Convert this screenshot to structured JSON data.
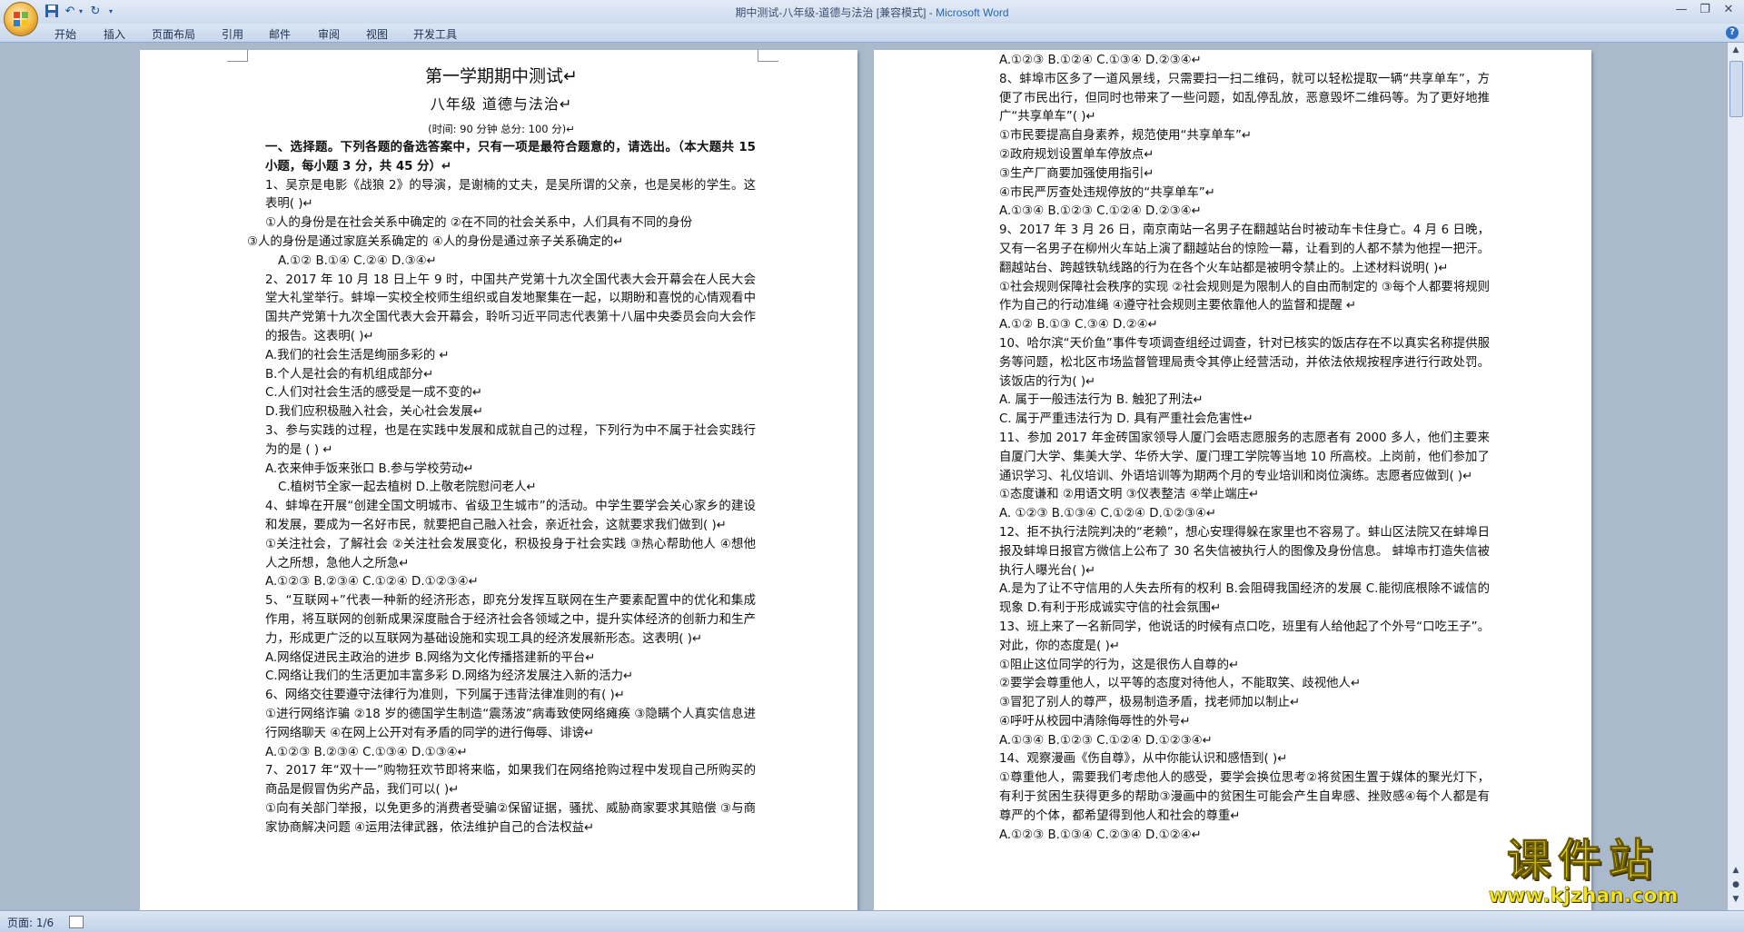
{
  "window": {
    "title": "期中测试-八年级-道德与法治 [兼容模式] - ",
    "app_name": "Microsoft Word"
  },
  "quick_access": [
    "save-icon",
    "undo-icon",
    "redo-icon",
    "customize-icon"
  ],
  "ribbon": {
    "tabs": [
      "开始",
      "插入",
      "页面布局",
      "引用",
      "邮件",
      "审阅",
      "视图",
      "开发工具"
    ],
    "help": "?"
  },
  "status": {
    "page": "页面: 1/6"
  },
  "watermark": {
    "title": "课件站",
    "url": "www.kjzhan.com"
  },
  "colors": {
    "title_bar": "#dfe8f5",
    "workspace": "#abb9cc",
    "watermark": "#f5e71d"
  },
  "page1": {
    "title": "第一学期期中测试↵",
    "subtitle": "八年级    道德与法治↵",
    "meta": "(时间: 90 分钟    总分: 100 分)↵",
    "section": "一、选择题。下列各题的备选答案中，只有一项是最符合题意的，请选出。（本大题共 15 小题，每小题 3 分，共 45 分）↵",
    "q1": "1、吴京是电影《战狼 2》的导演，是谢楠的丈夫，是吴所谓的父亲，也是吴彬的学生。这表明(      )↵",
    "q1_opts1": "①人的身份是在社会关系中确定的    ②在不同的社会关系中，人们具有不同的身份",
    "q1_opts2": "③人的身份是通过家庭关系确定的    ④人的身份是通过亲子关系确定的↵",
    "q1_choices": "A.①②               B.①④               C.②④               D.③④↵",
    "q2": "2、2017 年 10 月 18 日上午 9 时，中国共产党第十九次全国代表大会开幕会在人民大会堂大礼堂举行。蚌埠一实校全校师生组织或自发地聚集在一起，以期盼和喜悦的心情观看中国共产党第十九次全国代表大会开幕会，聆听习近平同志代表第十八届中央委员会向大会作的报告。这表明(      )↵",
    "q2_a": "A.我们的社会生活是绚丽多彩的      ↵",
    "q2_b": "B.个人是社会的有机组成部分↵",
    "q2_c": "C.人们对社会生活的感受是一成不变的↵",
    "q2_d": "D.我们应积极融入社会，关心社会发展↵",
    "q3": "3、参与实践的过程，也是在实践中发展和成就自己的过程，下列行为中不属于社会实践行为的是 (   ) ↵",
    "q3_ab": "A.衣来伸手饭来张口 B.参与学校劳动↵",
    "q3_cd": "C.植树节全家一起去植树 D.上敬老院慰问老人↵",
    "q4": "4、蚌埠在开展“创建全国文明城市、省级卫生城市”的活动。中学生要学会关心家乡的建设和发展，要成为一名好市民，就要把自己融入社会，亲近社会，这就要求我们做到(        )↵",
    "q4_opts": "①关注社会，了解社会  ②关注社会发展变化，积极投身于社会实践  ③热心帮助他人  ④想他人之所想，急他人之所急↵",
    "q4_choices": "A.①②③        B.②③④        C.①②④        D.①②③④↵",
    "q5": "5、“互联网+”代表一种新的经济形态，即充分发挥互联网在生产要素配置中的优化和集成作用，将互联网的创新成果深度融合于经济社会各领域之中，提升实体经济的创新力和生产力，形成更广泛的以互联网为基础设施和实现工具的经济发展新形态。这表明(        )↵",
    "q5_ab": "A.网络促进民主政治的进步        B.网络为文化传播搭建新的平台↵",
    "q5_cd": "C.网络让我们的生活更加丰富多彩 D.网络为经济发展注入新的活力↵",
    "q6": "6、网络交往要遵守法律行为准则，下列属于违背法律准则的有(         )↵",
    "q6_opts": "①进行网络诈骗  ②18 岁的德国学生制造“震荡波”病毒致使网络瘫痪  ③隐瞒个人真实信息进行网络聊天  ④在网上公开对有矛盾的同学的进行侮辱、诽谤↵",
    "q6_choices": "A.①②③               B.②③④               C.①③④               D.①③④↵",
    "q7": "7、2017 年“双十一”购物狂欢节即将来临，如果我们在网络抢购过程中发现自己所购买的商品是假冒伪劣产品，我们可以(       )↵",
    "q7_opts": "①向有关部门举报，以免更多的消费者受骗②保留证据，骚扰、威胁商家要求其赔偿 ③与商家协商解决问题 ④运用法律武器，依法维护自己的合法权益↵"
  },
  "page2": {
    "q7_choices": "A.①②③               B.①②④               C.①③④               D.②③④↵",
    "q8": "8、蚌埠市区多了一道风景线，只需要扫一扫二维码，就可以轻松提取一辆“共享单车”，方便了市民出行，但同时也带来了一些问题，如乱停乱放，恶意毁坏二维码等。为了更好地推广“共享单车”(        )↵",
    "q8_o1": "①市民要提高自身素养，规范使用“共享单车”↵",
    "q8_o2": "②政府规划设置单车停放点↵",
    "q8_o3": "③生产厂商要加强使用指引↵",
    "q8_o4": "④市民严厉查处违规停放的“共享单车”↵",
    "q8_choices": "A.①③④          B.①②③          C.①②④          D.②③④↵",
    "q9": "9、2017 年 3 月 26 日，南京南站一名男子在翻越站台时被动车卡住身亡。4 月 6 日晚，又有一名男子在柳州火车站上演了翻越站台的惊险一幕，让看到的人都不禁为他捏一把汗。翻越站台、跨越铁轨线路的行为在各个火车站都是被明令禁止的。上述材料说明(        )↵",
    "q9_opts": "①社会规则保障社会秩序的实现  ②社会规则是为限制人的自由而制定的  ③每个人都要将规则作为自己的行动准绳  ④遵守社会规则主要依靠他人的监督和提醒       ↵",
    "q9_choices": "A.①②    B.①③    C.③④    D.②④↵",
    "q10": "10、哈尔滨“天价鱼”事件专项调查组经过调查，针对已核实的饭店存在不以真实名称提供服务等问题，松北区市场监督管理局责令其停止经营活动，并依法依规按程序进行行政处罚。该饭店的行为(          )↵",
    "q10_ab": "A. 属于一般违法行为          B. 触犯了刑法↵",
    "q10_cd": "C. 属于严重违法行为          D. 具有严重社会危害性↵",
    "q11": "11、参加 2017 年金砖国家领导人厦门会晤志愿服务的志愿者有 2000 多人，他们主要来自厦门大学、集美大学、华侨大学、厦门理工学院等当地 10 所高校。上岗前，他们参加了通识学习、礼仪培训、外语培训等为期两个月的专业培训和岗位演练。志愿者应做到(        )↵",
    "q11_opts": "①态度谦和      ②用语文明        ③仪表整洁      ④举止端庄↵",
    "q11_choices": "A.   ①②③           B.①③④   C.①②④           D.①②③④↵",
    "q12": "12、拒不执行法院判决的“老赖”，想心安理得躲在家里也不容易了。蚌山区法院又在蚌埠日报及蚌埠日报官方微信上公布了 30 名失信被执行人的图像及身份信息。 蚌埠市打造失信被执行人曝光台(          )↵",
    "q12_ab": "A.是为了让不守信用的人失去所有的权利   B.会阻碍我国经济的发展 C.能彻底根除不诚信的现象        D.有利于形成诚实守信的社会氛围↵",
    "q13": "13、班上来了一名新同学，他说话的时候有点口吃，班里有人给他起了个外号“口吃王子”。对此，你的态度是(          )↵",
    "q13_o1": "①阻止这位同学的行为，这是很伤人自尊的↵",
    "q13_o2": "②要学会尊重他人，以平等的态度对待他人，不能取笑、歧视他人↵",
    "q13_o3": "③冒犯了别人的尊严，极易制造矛盾，找老师加以制止↵",
    "q13_o4": "④呼吁从校园中清除侮辱性的外号↵",
    "q13_choices": "A.①③④          B.①②③    C.①②④          D.①②③④↵",
    "q14": "14、观察漫画《伤自尊》，从中你能认识和感悟到(       )↵",
    "q14_opts": "①尊重他人，需要我们考虑他人的感受，要学会换位思考②将贫困生置于媒体的聚光灯下，有利于贫困生获得更多的帮助③漫画中的贫困生可能会产生自卑感、挫败感④每个人都是有尊严的个体，都希望得到他人和社会的尊重↵",
    "q14_choices": "A.①②③    B.①③④    C.②③④ D.①②④↵"
  }
}
